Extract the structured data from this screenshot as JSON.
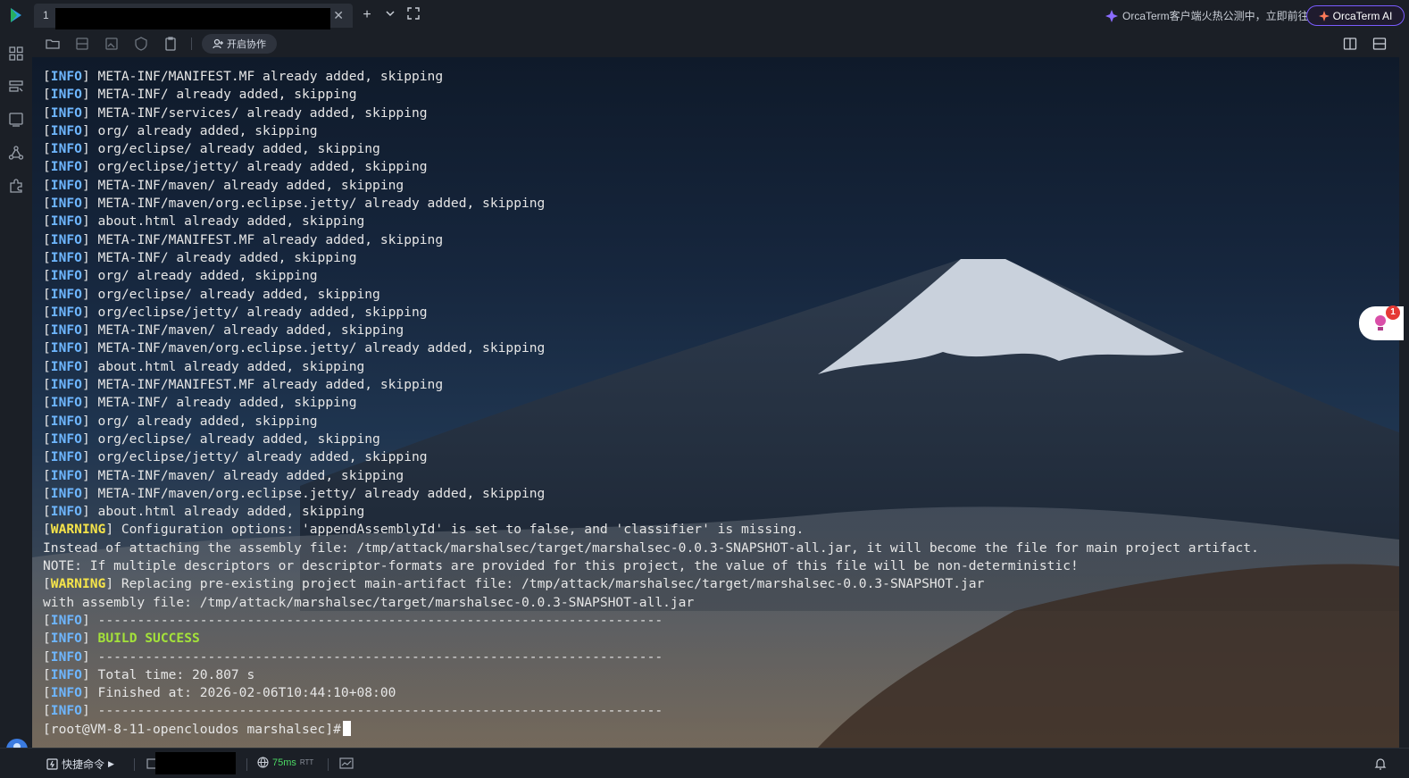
{
  "window": {
    "tab_number": "1",
    "promo_text": "OrcaTerm客户端火热公测中，立即前往",
    "ai_button": "OrcaTerm AI"
  },
  "toolbar": {
    "collab_label": "开启协作"
  },
  "float_widget": {
    "badge": "1"
  },
  "terminal": {
    "lines": [
      {
        "level": "INFO",
        "text": " META-INF/MANIFEST.MF already added, skipping"
      },
      {
        "level": "INFO",
        "text": " META-INF/ already added, skipping"
      },
      {
        "level": "INFO",
        "text": " META-INF/services/ already added, skipping"
      },
      {
        "level": "INFO",
        "text": " org/ already added, skipping"
      },
      {
        "level": "INFO",
        "text": " org/eclipse/ already added, skipping"
      },
      {
        "level": "INFO",
        "text": " org/eclipse/jetty/ already added, skipping"
      },
      {
        "level": "INFO",
        "text": " META-INF/maven/ already added, skipping"
      },
      {
        "level": "INFO",
        "text": " META-INF/maven/org.eclipse.jetty/ already added, skipping"
      },
      {
        "level": "INFO",
        "text": " about.html already added, skipping"
      },
      {
        "level": "INFO",
        "text": " META-INF/MANIFEST.MF already added, skipping"
      },
      {
        "level": "INFO",
        "text": " META-INF/ already added, skipping"
      },
      {
        "level": "INFO",
        "text": " org/ already added, skipping"
      },
      {
        "level": "INFO",
        "text": " org/eclipse/ already added, skipping"
      },
      {
        "level": "INFO",
        "text": " org/eclipse/jetty/ already added, skipping"
      },
      {
        "level": "INFO",
        "text": " META-INF/maven/ already added, skipping"
      },
      {
        "level": "INFO",
        "text": " META-INF/maven/org.eclipse.jetty/ already added, skipping"
      },
      {
        "level": "INFO",
        "text": " about.html already added, skipping"
      },
      {
        "level": "INFO",
        "text": " META-INF/MANIFEST.MF already added, skipping"
      },
      {
        "level": "INFO",
        "text": " META-INF/ already added, skipping"
      },
      {
        "level": "INFO",
        "text": " org/ already added, skipping"
      },
      {
        "level": "INFO",
        "text": " org/eclipse/ already added, skipping"
      },
      {
        "level": "INFO",
        "text": " org/eclipse/jetty/ already added, skipping"
      },
      {
        "level": "INFO",
        "text": " META-INF/maven/ already added, skipping"
      },
      {
        "level": "INFO",
        "text": " META-INF/maven/org.eclipse.jetty/ already added, skipping"
      },
      {
        "level": "INFO",
        "text": " about.html already added, skipping"
      },
      {
        "level": "WARNING",
        "text": " Configuration options: 'appendAssemblyId' is set to false, and 'classifier' is missing."
      },
      {
        "level": "",
        "text": "Instead of attaching the assembly file: /tmp/attack/marshalsec/target/marshalsec-0.0.3-SNAPSHOT-all.jar, it will become the file for main project artifact."
      },
      {
        "level": "",
        "text": "NOTE: If multiple descriptors or descriptor-formats are provided for this project, the value of this file will be non-deterministic!"
      },
      {
        "level": "WARNING",
        "text": " Replacing pre-existing project main-artifact file: /tmp/attack/marshalsec/target/marshalsec-0.0.3-SNAPSHOT.jar"
      },
      {
        "level": "",
        "text": "with assembly file: /tmp/attack/marshalsec/target/marshalsec-0.0.3-SNAPSHOT-all.jar"
      },
      {
        "level": "INFO",
        "text": " ------------------------------------------------------------------------"
      },
      {
        "level": "INFO",
        "text": " ",
        "success": "BUILD SUCCESS"
      },
      {
        "level": "INFO",
        "text": " ------------------------------------------------------------------------"
      },
      {
        "level": "INFO",
        "text": " Total time: 20.807 s"
      },
      {
        "level": "INFO",
        "text": " Finished at: 2026-02-06T10:44:10+08:00"
      },
      {
        "level": "INFO",
        "text": " ------------------------------------------------------------------------"
      }
    ],
    "prompt": "[root@VM-8-11-opencloudos marshalsec]# "
  },
  "statusbar": {
    "quick_cmd": "快捷命令",
    "latency_value": "75ms",
    "latency_unit": "RTT"
  },
  "colors": {
    "info": "#6eb6ff",
    "warning": "#f5e34a",
    "success": "#a4e23a",
    "accent": "#7a5cff"
  }
}
